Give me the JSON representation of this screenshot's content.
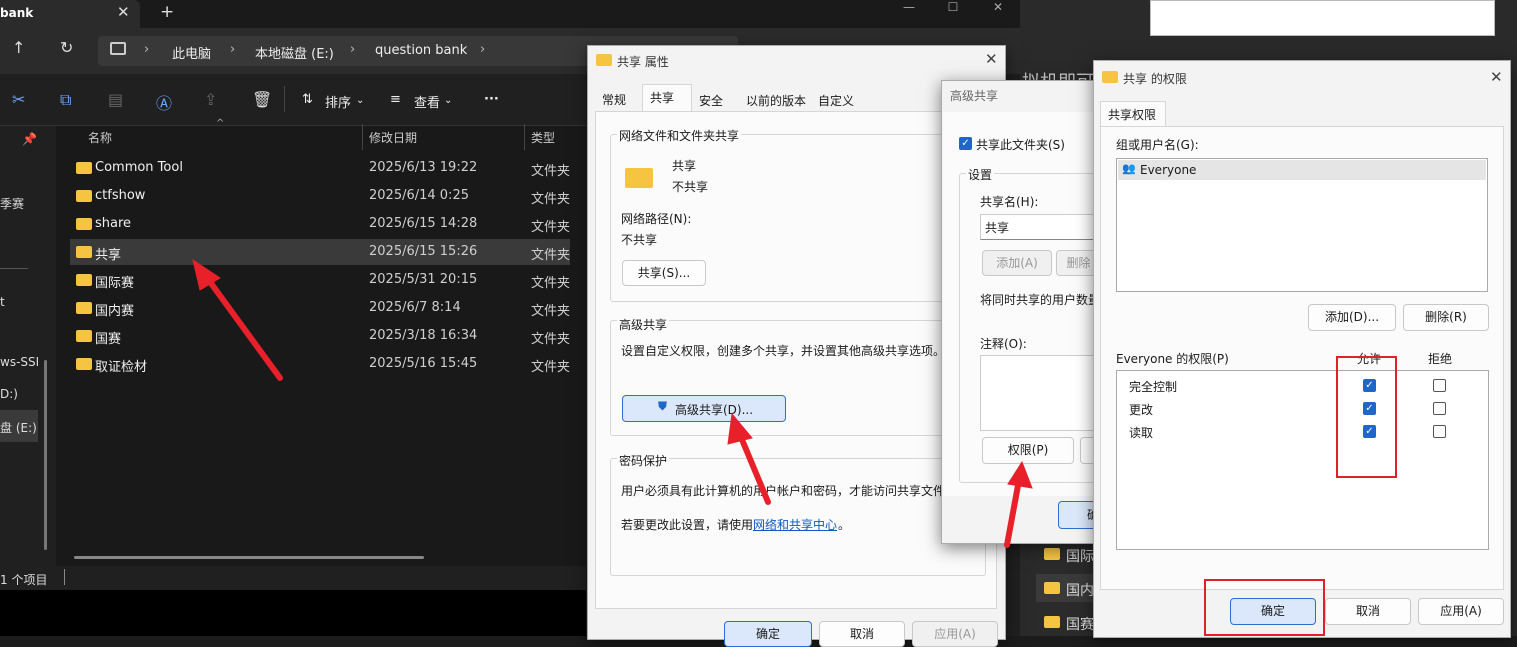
{
  "explorer": {
    "tab_title": "bank",
    "breadcrumbs": [
      "此电脑",
      "本地磁盘 (E:)",
      "question bank"
    ],
    "toolbar": {
      "sort": "排序",
      "view": "查看"
    },
    "columns": [
      "名称",
      "修改日期",
      "类型"
    ],
    "files": [
      {
        "name": "Common Tool",
        "date": "2025/6/13 19:22",
        "type": "文件夹"
      },
      {
        "name": "ctfshow",
        "date": "2025/6/14 0:25",
        "type": "文件夹"
      },
      {
        "name": "share",
        "date": "2025/6/15 14:28",
        "type": "文件夹"
      },
      {
        "name": "共享",
        "date": "2025/6/15 15:26",
        "type": "文件夹"
      },
      {
        "name": "国际赛",
        "date": "2025/5/31 20:15",
        "type": "文件夹"
      },
      {
        "name": "国内赛",
        "date": "2025/6/7 8:14",
        "type": "文件夹"
      },
      {
        "name": "国赛",
        "date": "2025/3/18 16:34",
        "type": "文件夹"
      },
      {
        "name": "取证检材",
        "date": "2025/5/16 15:45",
        "type": "文件夹"
      }
    ],
    "sidebar_labels": [
      "季赛",
      "ws-SSI",
      "D:)",
      "盘 (E:)"
    ],
    "status": "1 个项目"
  },
  "props": {
    "title": "共享 属性",
    "tabs": [
      "常规",
      "共享",
      "安全",
      "以前的版本",
      "自定义"
    ],
    "net_section": "网络文件和文件夹共享",
    "folder_name": "共享",
    "folder_state": "不共享",
    "net_path_label": "网络路径(N):",
    "net_path_value": "不共享",
    "share_btn": "共享(S)...",
    "adv_section": "高级共享",
    "adv_desc": "设置自定义权限，创建多个共享，并设置其他高级共享选项。",
    "adv_btn": "高级共享(D)...",
    "pwd_section": "密码保护",
    "pwd_desc": "用户必须具有此计算机的用户帐户和密码，才能访问共享文件",
    "pwd_change_prefix": "若要更改此设置，请使用",
    "pwd_link": "网络和共享中心",
    "pwd_change_suffix": "。",
    "ok": "确定",
    "cancel": "取消",
    "apply": "应用(A)"
  },
  "adv": {
    "title": "高级共享",
    "share_check": "共享此文件夹(S)",
    "settings": "设置",
    "share_name_label": "共享名(H):",
    "share_name_value": "共享",
    "add_btn": "添加(A)",
    "remove_btn": "删除",
    "limit_label": "将同时共享的用户数量",
    "comment_label": "注释(O):",
    "perm_btn": "权限(P)",
    "ok_partial": "确"
  },
  "perm": {
    "title": "共享 的权限",
    "tab": "共享权限",
    "group_label": "组或用户名(G):",
    "user": "Everyone",
    "add_btn": "添加(D)...",
    "remove_btn": "删除(R)",
    "perm_label": "Everyone 的权限(P)",
    "allow": "允许",
    "deny": "拒绝",
    "rows": [
      {
        "name": "完全控制",
        "allow": true,
        "deny": false
      },
      {
        "name": "更改",
        "allow": true,
        "deny": false
      },
      {
        "name": "读取",
        "allow": true,
        "deny": false
      }
    ],
    "ok": "确定",
    "cancel": "取消",
    "apply": "应用(A)"
  },
  "background": {
    "right_text": "拟机即可",
    "folders": [
      "国际",
      "国内",
      "国赛"
    ]
  },
  "colors": {
    "annotation_red": "#e0202a",
    "accent_blue": "#1e66c9"
  }
}
